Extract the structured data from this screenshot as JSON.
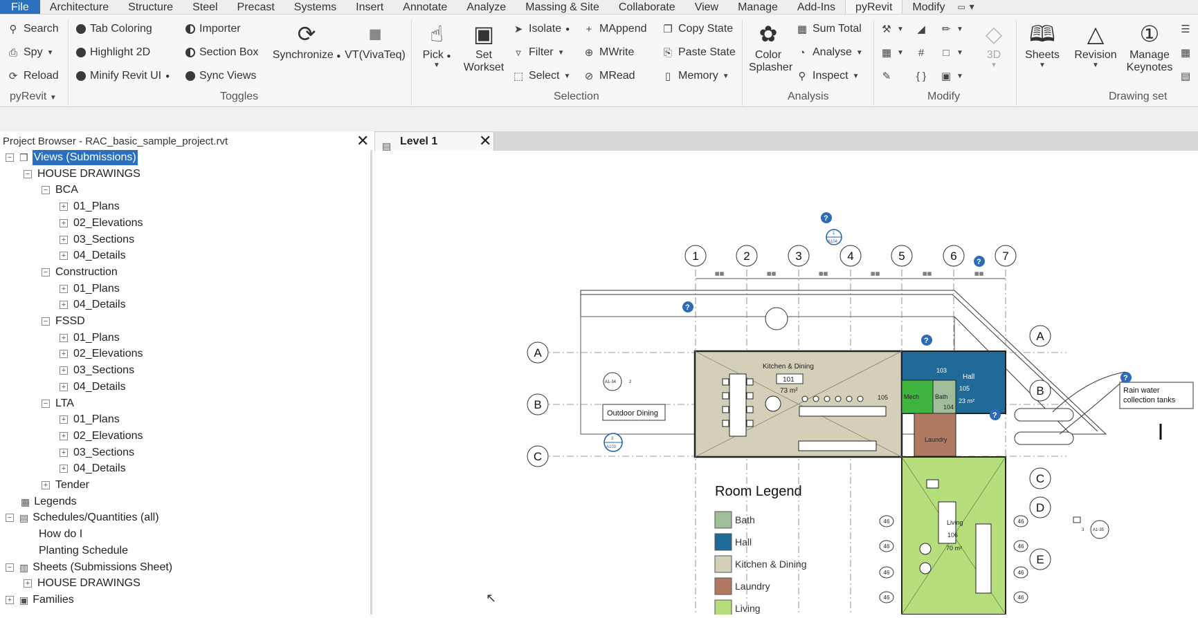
{
  "tabs": [
    "File",
    "Architecture",
    "Structure",
    "Steel",
    "Precast",
    "Systems",
    "Insert",
    "Annotate",
    "Analyze",
    "Massing & Site",
    "Collaborate",
    "View",
    "Manage",
    "Add-Ins",
    "pyRevit",
    "Modify"
  ],
  "active_tab": "pyRevit",
  "ribbon": {
    "pyrevit": {
      "search": "Search",
      "spy": "Spy",
      "reload": "Reload",
      "label": "pyRevit"
    },
    "toggles": {
      "tab_coloring": "Tab Coloring",
      "highlight_2d": "Highlight 2D",
      "minify": "Minify Revit UI",
      "importer": "Importer",
      "section_box": "Section Box",
      "sync_views": "Sync Views",
      "synchronize": "Synchronize",
      "vt": "VT(VivaTeq)",
      "label": "Toggles"
    },
    "selection": {
      "pick": "Pick",
      "set_workset_1": "Set",
      "set_workset_2": "Workset",
      "isolate": "Isolate",
      "filter": "Filter",
      "select": "Select",
      "mappend": "MAppend",
      "mwrite": "MWrite",
      "mread": "MRead",
      "copy_state": "Copy State",
      "paste_state": "Paste State",
      "memory": "Memory",
      "label": "Selection"
    },
    "analysis": {
      "color_1": "Color",
      "color_2": "Splasher",
      "sum_total": "Sum Total",
      "analyse": "Analyse",
      "inspect": "Inspect",
      "label": "Analysis"
    },
    "modify": {
      "view_3d": "3D",
      "label": "Modify"
    },
    "drawing_set": {
      "sheets": "Sheets",
      "revision": "Revision",
      "manage_1": "Manage",
      "manage_2": "Keynotes",
      "label": "Drawing set"
    }
  },
  "project_browser": {
    "title": "Project Browser - RAC_basic_sample_project.rvt",
    "tree": [
      {
        "label": "Views (Submissions)",
        "level": 0,
        "box": "−",
        "icon": "views",
        "selected": true
      },
      {
        "label": "HOUSE DRAWINGS",
        "level": 1,
        "box": "−"
      },
      {
        "label": "BCA",
        "level": 2,
        "box": "−"
      },
      {
        "label": "01_Plans",
        "level": 3,
        "box": "+"
      },
      {
        "label": "02_Elevations",
        "level": 3,
        "box": "+"
      },
      {
        "label": "03_Sections",
        "level": 3,
        "box": "+"
      },
      {
        "label": "04_Details",
        "level": 3,
        "box": "+"
      },
      {
        "label": "Construction",
        "level": 2,
        "box": "−"
      },
      {
        "label": "01_Plans",
        "level": 3,
        "box": "+"
      },
      {
        "label": "04_Details",
        "level": 3,
        "box": "+"
      },
      {
        "label": "FSSD",
        "level": 2,
        "box": "−"
      },
      {
        "label": "01_Plans",
        "level": 3,
        "box": "+"
      },
      {
        "label": "02_Elevations",
        "level": 3,
        "box": "+"
      },
      {
        "label": "03_Sections",
        "level": 3,
        "box": "+"
      },
      {
        "label": "04_Details",
        "level": 3,
        "box": "+"
      },
      {
        "label": "LTA",
        "level": 2,
        "box": "−"
      },
      {
        "label": "01_Plans",
        "level": 3,
        "box": "+"
      },
      {
        "label": "02_Elevations",
        "level": 3,
        "box": "+"
      },
      {
        "label": "03_Sections",
        "level": 3,
        "box": "+"
      },
      {
        "label": "04_Details",
        "level": 3,
        "box": "+"
      },
      {
        "label": "Tender",
        "level": 2,
        "box": "+"
      },
      {
        "label": "Legends",
        "level": 0,
        "box": "",
        "icon": "legend"
      },
      {
        "label": "Schedules/Quantities (all)",
        "level": 0,
        "box": "−",
        "icon": "schedule"
      },
      {
        "label": "How do I",
        "level": 1,
        "box": ""
      },
      {
        "label": "Planting Schedule",
        "level": 1,
        "box": ""
      },
      {
        "label": "Sheets (Submissions Sheet)",
        "level": 0,
        "box": "−",
        "icon": "sheet"
      },
      {
        "label": "HOUSE DRAWINGS",
        "level": 1,
        "box": "+"
      },
      {
        "label": "Families",
        "level": 0,
        "box": "+",
        "icon": "family"
      }
    ]
  },
  "view_tab": {
    "title": "Level 1"
  },
  "drawing": {
    "grid_numbers": [
      "1",
      "2",
      "3",
      "4",
      "5",
      "6",
      "7"
    ],
    "grid_letters_left": [
      "A",
      "B",
      "C"
    ],
    "grid_letters_right": [
      "A",
      "B",
      "C",
      "D",
      "E"
    ],
    "rooms": {
      "kitchen": "Kitchen & Dining",
      "kitchen_num": "101",
      "kitchen_area": "73 m²",
      "hall": "Hall",
      "hall_num": "103",
      "hall_num2": "105",
      "hall_area": "23 m²",
      "bath": "Bath",
      "bath_num": "104",
      "mech": "Mech",
      "mech_num": "105",
      "laundry": "Laundry",
      "living": "Living",
      "living_num": "106",
      "living_area": "70 m²"
    },
    "outdoor": "Outdoor Dining",
    "rain": [
      "Rain water",
      "collection tanks"
    ],
    "tags": {
      "a104_top": "1",
      "a104_bottom": "A104",
      "a103_top": "3",
      "a103_bottom": "A103",
      "a134": "A1-34",
      "a134_num": "2",
      "a135": "A1-35",
      "a135_num": "3"
    },
    "dim_mark": "46"
  },
  "room_legend": {
    "title": "Room Legend",
    "items": [
      {
        "label": "Bath",
        "color": "#9fbd98"
      },
      {
        "label": "Hall",
        "color": "#1f6a97"
      },
      {
        "label": "Kitchen & Dining",
        "color": "#d4cfb8"
      },
      {
        "label": "Laundry",
        "color": "#b07a62"
      },
      {
        "label": "Living",
        "color": "#b6de7c"
      }
    ]
  }
}
